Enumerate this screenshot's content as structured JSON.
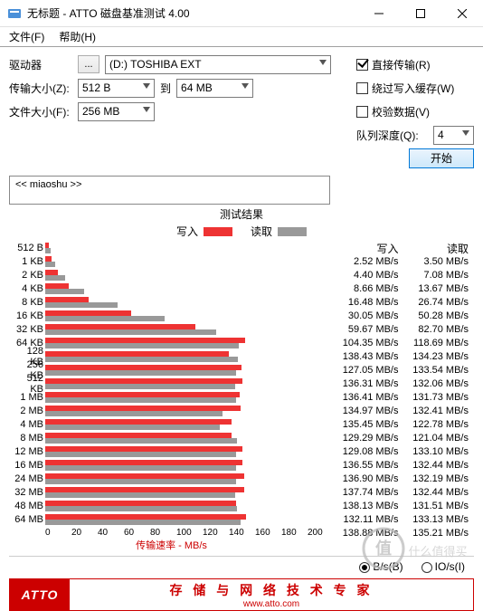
{
  "window": {
    "title": "无标题 - ATTO 磁盘基准测试 4.00"
  },
  "menu": {
    "file": "文件(F)",
    "help": "帮助(H)"
  },
  "controls": {
    "drive_label": "驱动器",
    "ellipsis": "...",
    "drive": "(D:) TOSHIBA EXT",
    "tsize_label": "传输大小(Z):",
    "tsize_from": "512 B",
    "to": "到",
    "tsize_to": "64 MB",
    "fsize_label": "文件大小(F):",
    "fsize": "256 MB"
  },
  "options": {
    "direct": {
      "label": "直接传输(R)",
      "checked": true
    },
    "bypass": {
      "label": "绕过写入缓存(W)",
      "checked": false
    },
    "verify": {
      "label": "校验数据(V)",
      "checked": false
    },
    "qdepth_label": "队列深度(Q):",
    "qdepth": "4",
    "start": "开始"
  },
  "desc": {
    "text": "<< miaoshu >>"
  },
  "results_title": "测试结果",
  "legend": {
    "write": "写入",
    "read": "读取"
  },
  "axis": {
    "title": "传输速率 - MB/s",
    "ticks": [
      "0",
      "20",
      "40",
      "60",
      "80",
      "100",
      "120",
      "140",
      "160",
      "180",
      "200"
    ]
  },
  "units": {
    "bps_label": "B/s(B)",
    "iops_label": "IO/s(I)"
  },
  "columns": {
    "write": "写入",
    "read": "读取"
  },
  "max": 200,
  "chart_data": {
    "type": "bar",
    "title": "测试结果",
    "xlabel": "传输速率 - MB/s",
    "ylabel": "",
    "xlim": [
      0,
      200
    ],
    "unit": "MB/s",
    "categories": [
      "512 B",
      "1 KB",
      "2 KB",
      "4 KB",
      "8 KB",
      "16 KB",
      "32 KB",
      "64 KB",
      "128 KB",
      "256 KB",
      "512 KB",
      "1 MB",
      "2 MB",
      "4 MB",
      "8 MB",
      "12 MB",
      "16 MB",
      "24 MB",
      "32 MB",
      "48 MB",
      "64 MB"
    ],
    "series": [
      {
        "name": "写入",
        "values": [
          2.52,
          4.4,
          8.66,
          16.48,
          30.05,
          59.67,
          104.35,
          138.43,
          127.05,
          136.31,
          136.41,
          134.97,
          135.45,
          129.29,
          129.08,
          136.55,
          136.9,
          137.74,
          138.13,
          132.11,
          138.88
        ]
      },
      {
        "name": "读取",
        "values": [
          3.5,
          7.08,
          13.67,
          26.74,
          50.28,
          82.7,
          118.69,
          134.23,
          133.54,
          132.06,
          131.73,
          132.41,
          122.78,
          121.04,
          133.1,
          132.44,
          132.19,
          132.44,
          131.51,
          133.13,
          135.21
        ]
      }
    ]
  },
  "banner": {
    "logo": "ATTO",
    "line1": "存 储 与 网 络 技 术 专 家",
    "line2": "www.atto.com"
  },
  "watermark": {
    "text": "值 什么值得买"
  }
}
